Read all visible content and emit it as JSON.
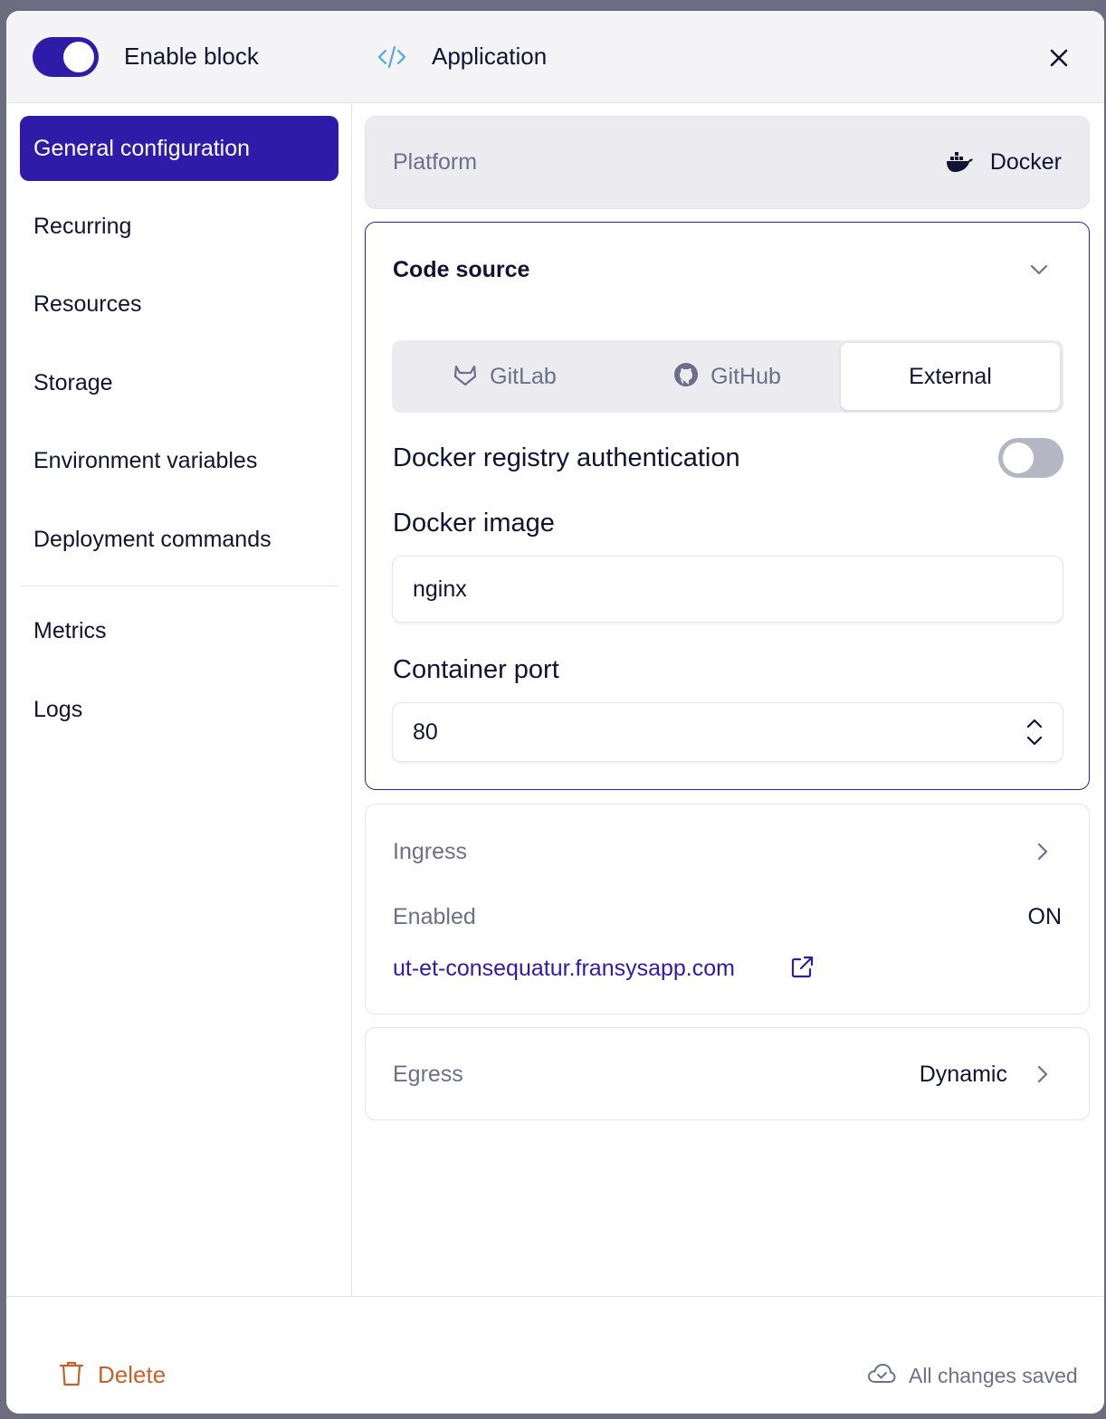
{
  "header": {
    "enable_label": "Enable block",
    "enabled": true,
    "title": "Application",
    "title_icon": "code-icon",
    "close_icon": "close-icon"
  },
  "sidebar": {
    "items": [
      {
        "label": "General configuration",
        "active": true
      },
      {
        "label": "Recurring",
        "active": false
      },
      {
        "label": "Resources",
        "active": false
      },
      {
        "label": "Storage",
        "active": false
      },
      {
        "label": "Environment variables",
        "active": false
      },
      {
        "label": "Deployment commands",
        "active": false
      }
    ],
    "secondary_items": [
      {
        "label": "Metrics"
      },
      {
        "label": "Logs"
      }
    ]
  },
  "platform": {
    "label": "Platform",
    "value": "Docker",
    "icon": "docker-icon"
  },
  "code_source": {
    "title": "Code source",
    "tabs": [
      {
        "label": "GitLab",
        "icon": "gitlab-icon",
        "selected": false
      },
      {
        "label": "GitHub",
        "icon": "github-icon",
        "selected": false
      },
      {
        "label": "External",
        "selected": true
      }
    ],
    "registry_auth_label": "Docker registry authentication",
    "registry_auth_enabled": false,
    "image_label": "Docker image",
    "image_value": "nginx",
    "port_label": "Container port",
    "port_value": "80"
  },
  "ingress": {
    "title": "Ingress",
    "enabled_label": "Enabled",
    "enabled_value": "ON",
    "url": "ut-et-consequatur.fransysapp.com"
  },
  "egress": {
    "title": "Egress",
    "value": "Dynamic"
  },
  "footer": {
    "delete_label": "Delete",
    "status_label": "All changes saved"
  },
  "colors": {
    "accent": "#2e1ba8",
    "delete": "#c4622d",
    "muted": "#6d6f8a"
  }
}
